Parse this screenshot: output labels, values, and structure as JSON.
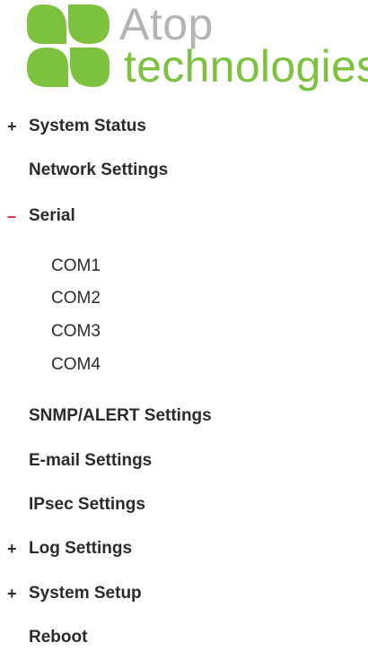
{
  "logo": {
    "line1": "Atop",
    "line2": "technologies",
    "colors": {
      "green": "#7cc23e",
      "gray": "#b4b4b4"
    }
  },
  "menu": {
    "items": [
      {
        "marker": "+",
        "label": "System Status"
      },
      {
        "marker": "",
        "label": "Network Settings"
      },
      {
        "marker": "–",
        "label": "Serial",
        "expanded": true
      },
      {
        "marker": "",
        "label": "SNMP/ALERT Settings"
      },
      {
        "marker": "",
        "label": "E-mail Settings"
      },
      {
        "marker": "",
        "label": "IPsec Settings"
      },
      {
        "marker": "+",
        "label": "Log Settings"
      },
      {
        "marker": "+",
        "label": "System Setup"
      },
      {
        "marker": "",
        "label": "Reboot"
      }
    ],
    "serial_subitems": [
      {
        "label": "COM1"
      },
      {
        "label": "COM2"
      },
      {
        "label": "COM3"
      },
      {
        "label": "COM4"
      }
    ]
  },
  "colors": {
    "text": "#2b2b2b",
    "collapse_marker": "#d22a2a"
  }
}
